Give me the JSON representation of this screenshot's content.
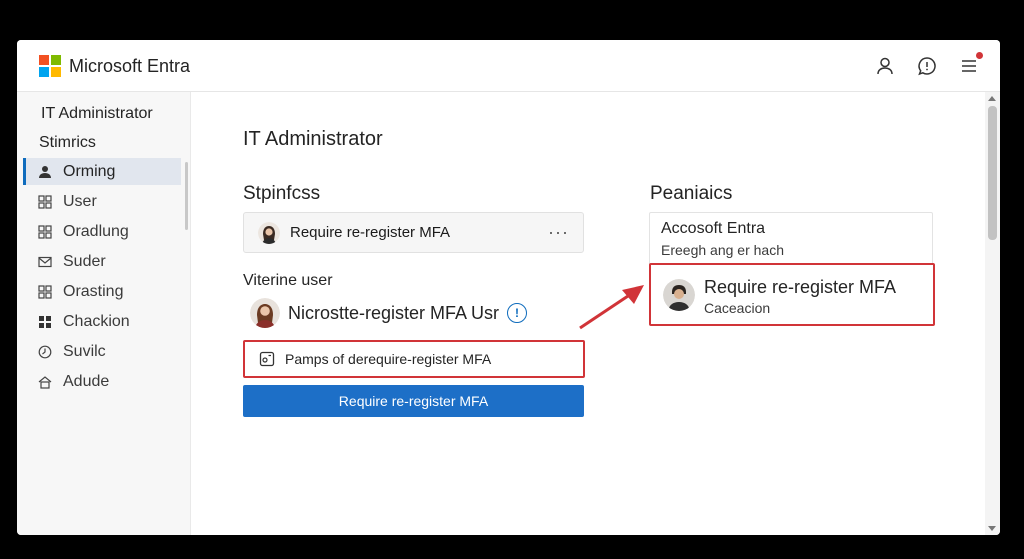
{
  "app": {
    "title": "Microsoft Entra"
  },
  "colors": {
    "accent": "#1d6fc7",
    "highlight": "#d13438",
    "notification": "#d13438"
  },
  "top_icons": [
    "person-icon",
    "feedback-icon",
    "menu-icon"
  ],
  "sidebar": {
    "heading": "IT Administrator",
    "subheading": "Stimrics",
    "items": [
      {
        "label": "Orming",
        "icon": "person-icon",
        "active": true
      },
      {
        "label": "User",
        "icon": "apps-icon"
      },
      {
        "label": "Oradlung",
        "icon": "apps-icon"
      },
      {
        "label": "Suder",
        "icon": "mail-icon"
      },
      {
        "label": "Orasting",
        "icon": "apps-icon"
      },
      {
        "label": "Chackion",
        "icon": "grid-icon"
      },
      {
        "label": "Suvilc",
        "icon": "clock-icon"
      },
      {
        "label": "Adude",
        "icon": "home-icon"
      }
    ]
  },
  "main": {
    "title": "IT Administrator",
    "left_section": {
      "title": "Stpinfcss",
      "card_text": "Require re-register MFA",
      "more": "···",
      "label": "Viterine user",
      "user_text": "Nicrostte-register MFA Usr",
      "info": "!",
      "highlight_text": "Pamps of derequire-register MFA",
      "button_label": "Require re-register MFA"
    },
    "right_section": {
      "title": "Peaniaics",
      "card_title": "Accosoft Entra",
      "card_subtitle": "Ereegh ang er hach",
      "highlight_title": "Require re-register MFA",
      "highlight_subtitle": "Caceacion"
    }
  }
}
